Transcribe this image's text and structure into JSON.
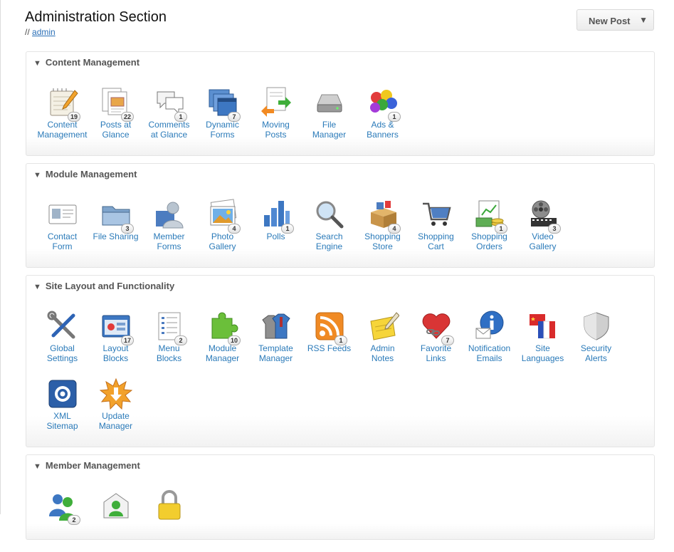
{
  "header": {
    "title": "Administration Section",
    "breadcrumb_prefix": "//",
    "breadcrumb_link": "admin",
    "new_post_label": "New Post",
    "new_post_arrow": "▼"
  },
  "panels": [
    {
      "title": "Content Management",
      "items": [
        {
          "l1": "Content",
          "l2": "Management",
          "badge": "19",
          "icon": "notepad-pencil-icon"
        },
        {
          "l1": "Posts at",
          "l2": "Glance",
          "badge": "22",
          "icon": "documents-stack-icon"
        },
        {
          "l1": "Comments",
          "l2": "at Glance",
          "badge": "1",
          "icon": "speech-bubbles-icon"
        },
        {
          "l1": "Dynamic",
          "l2": "Forms",
          "badge": "7",
          "icon": "forms-windows-icon"
        },
        {
          "l1": "Moving",
          "l2": "Posts",
          "badge": "",
          "icon": "move-documents-icon"
        },
        {
          "l1": "File",
          "l2": "Manager",
          "badge": "",
          "icon": "hard-drive-icon"
        },
        {
          "l1": "Ads &",
          "l2": "Banners",
          "badge": "1",
          "icon": "colored-balls-icon"
        }
      ]
    },
    {
      "title": "Module Management",
      "items": [
        {
          "l1": "Contact",
          "l2": "Form",
          "badge": "",
          "icon": "contact-card-icon"
        },
        {
          "l1": "File Sharing",
          "l2": "",
          "badge": "3",
          "icon": "shared-folder-icon"
        },
        {
          "l1": "Member",
          "l2": "Forms",
          "badge": "",
          "icon": "member-silhouette-icon"
        },
        {
          "l1": "Photo",
          "l2": "Gallery",
          "badge": "4",
          "icon": "photo-frames-icon"
        },
        {
          "l1": "Polls",
          "l2": "",
          "badge": "1",
          "icon": "bar-chart-icon"
        },
        {
          "l1": "Search",
          "l2": "Engine",
          "badge": "",
          "icon": "magnifier-icon"
        },
        {
          "l1": "Shopping",
          "l2": "Store",
          "badge": "4",
          "icon": "store-box-icon"
        },
        {
          "l1": "Shopping",
          "l2": "Cart",
          "badge": "",
          "icon": "shopping-cart-icon"
        },
        {
          "l1": "Shopping",
          "l2": "Orders",
          "badge": "1",
          "icon": "money-orders-icon"
        },
        {
          "l1": "Video",
          "l2": "Gallery",
          "badge": "3",
          "icon": "film-reel-icon"
        }
      ]
    },
    {
      "title": "Site Layout and Functionality",
      "items": [
        {
          "l1": "Global",
          "l2": "Settings",
          "badge": "",
          "icon": "wrench-screwdriver-icon"
        },
        {
          "l1": "Layout",
          "l2": "Blocks",
          "badge": "17",
          "icon": "layout-window-icon"
        },
        {
          "l1": "Menu",
          "l2": "Blocks",
          "badge": "2",
          "icon": "menu-list-icon"
        },
        {
          "l1": "Module",
          "l2": "Manager",
          "badge": "10",
          "icon": "puzzle-piece-icon"
        },
        {
          "l1": "Template",
          "l2": "Manager",
          "badge": "",
          "icon": "template-shirts-icon"
        },
        {
          "l1": "RSS Feeds",
          "l2": "",
          "badge": "1",
          "icon": "rss-icon"
        },
        {
          "l1": "Admin",
          "l2": "Notes",
          "badge": "",
          "icon": "sticky-note-icon"
        },
        {
          "l1": "Favorite",
          "l2": "Links",
          "badge": "7",
          "icon": "heart-chain-icon"
        },
        {
          "l1": "Notification",
          "l2": "Emails",
          "badge": "",
          "icon": "info-envelope-icon"
        },
        {
          "l1": "Site",
          "l2": "Languages",
          "badge": "",
          "icon": "flags-icon"
        },
        {
          "l1": "Security",
          "l2": "Alerts",
          "badge": "",
          "icon": "shield-icon"
        },
        {
          "l1": "XML",
          "l2": "Sitemap",
          "badge": "",
          "icon": "xml-sitemap-icon"
        },
        {
          "l1": "Update",
          "l2": "Manager",
          "badge": "",
          "icon": "update-starburst-icon"
        }
      ]
    },
    {
      "title": "Member Management",
      "items": [
        {
          "l1": "",
          "l2": "",
          "badge": "2",
          "icon": "users-group-icon"
        },
        {
          "l1": "",
          "l2": "",
          "badge": "",
          "icon": "member-mail-icon"
        },
        {
          "l1": "",
          "l2": "",
          "badge": "",
          "icon": "padlock-icon"
        }
      ]
    }
  ],
  "colors": {
    "link": "#2a7ab9",
    "heading": "#555555",
    "panel_border": "#e4e4e4"
  }
}
